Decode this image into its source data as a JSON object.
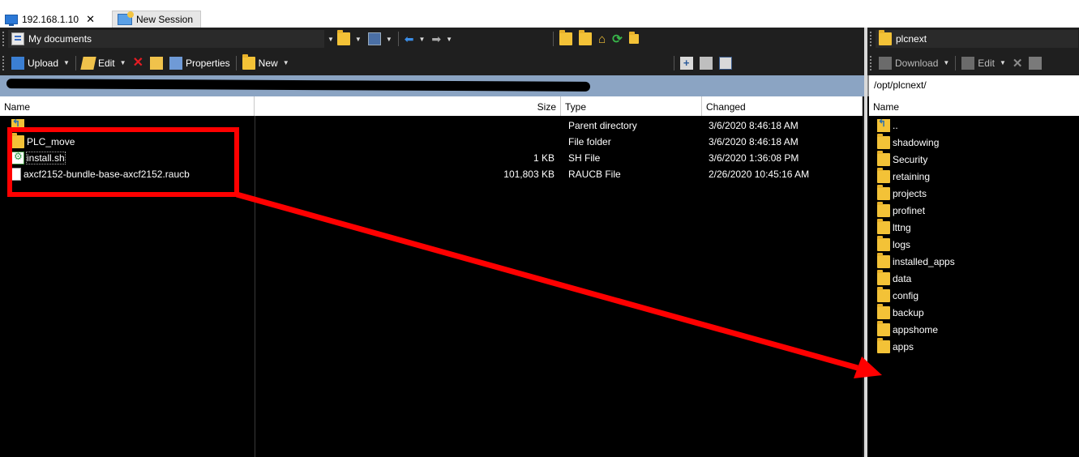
{
  "tabs": [
    {
      "label": "192.168.1.10",
      "icon": "monitor-icon",
      "close": "✕"
    },
    {
      "label": "New Session",
      "icon": "new-session-icon"
    }
  ],
  "left": {
    "location": "My documents",
    "toolbar": {
      "upload": "Upload",
      "edit": "Edit",
      "properties": "Properties",
      "new": "New"
    },
    "columns": [
      "Name",
      "Size",
      "Type",
      "Changed"
    ],
    "rows": [
      {
        "name": "..",
        "size": "",
        "type": "Parent directory",
        "changed": "3/6/2020 8:46:18 AM",
        "icon": "parent-folder-icon"
      },
      {
        "name": "PLC_move",
        "size": "",
        "type": "File folder",
        "changed": "3/6/2020 8:46:18 AM",
        "icon": "folder-icon"
      },
      {
        "name": "install.sh",
        "size": "1 KB",
        "type": "SH File",
        "changed": "3/6/2020 1:36:08 PM",
        "icon": "shell-script-icon"
      },
      {
        "name": "axcf2152-bundle-base-axcf2152.raucb",
        "size": "101,803 KB",
        "type": "RAUCB File",
        "changed": "2/26/2020 10:45:16 AM",
        "icon": "file-icon"
      }
    ]
  },
  "right": {
    "location": "plcnext",
    "path": "/opt/plcnext/",
    "toolbar": {
      "download": "Download",
      "edit": "Edit"
    },
    "columns": [
      "Name"
    ],
    "rows": [
      {
        "name": "..",
        "icon": "parent-folder-icon"
      },
      {
        "name": "shadowing"
      },
      {
        "name": "Security"
      },
      {
        "name": "retaining"
      },
      {
        "name": "projects"
      },
      {
        "name": "profinet"
      },
      {
        "name": "lttng"
      },
      {
        "name": "logs"
      },
      {
        "name": "installed_apps"
      },
      {
        "name": "data"
      },
      {
        "name": "config"
      },
      {
        "name": "backup"
      },
      {
        "name": "appshome"
      },
      {
        "name": "apps"
      }
    ]
  },
  "colors": {
    "annotation": "#ff0000",
    "pathbar": "#8ba4c3",
    "toolbar": "#1f1f1f",
    "folder": "#f3c237"
  }
}
